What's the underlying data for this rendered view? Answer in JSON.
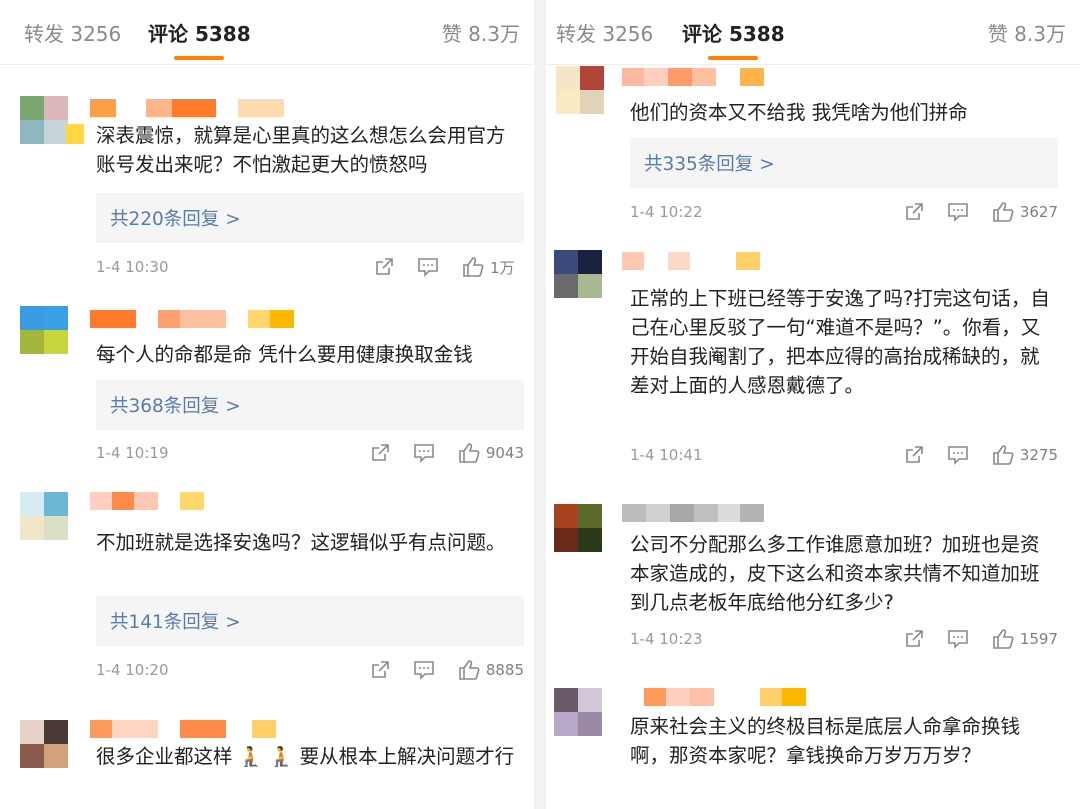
{
  "colors": {
    "accent": "#ff8200",
    "link": "#5a7ca7",
    "text": "#222222",
    "muted": "#9a9a9a"
  },
  "left": {
    "tabs": {
      "repost": "转发 3256",
      "comments": "评论 5388",
      "likes": "赞 8.3万"
    },
    "comments": [
      {
        "text": "深表震惊，就算是心里真的这么想怎么会用官方账号发出来呢？不怕激起更大的愤怒吗",
        "replies": "共220条回复 >",
        "time": "1-4 10:30",
        "likes": "1万"
      },
      {
        "text": "每个人的命都是命 凭什么要用健康换取金钱",
        "replies": "共368条回复 >",
        "time": "1-4 10:19",
        "likes": "9043"
      },
      {
        "text": "不加班就是选择安逸吗？这逻辑似乎有点问题。",
        "replies": "共141条回复 >",
        "time": "1-4 10:20",
        "likes": "8885"
      },
      {
        "text": "很多企业都这样 🧎 🧎 要从根本上解决问题才行"
      }
    ]
  },
  "right": {
    "tabs": {
      "repost": "转发 3256",
      "comments": "评论 5388",
      "likes": "赞 8.3万"
    },
    "comments": [
      {
        "text": "他们的资本又不给我 我凭啥为他们拼命",
        "replies": "共335条回复 >",
        "time": "1-4 10:22",
        "likes": "3627"
      },
      {
        "text": "正常的上下班已经等于安逸了吗?打完这句话，自己在心里反驳了一句“难道不是吗？”。你看，又开始自我阉割了，把本应得的高抬成稀缺的，就差对上面的人感恩戴德了。",
        "time": "1-4 10:41",
        "likes": "3275"
      },
      {
        "text": "公司不分配那么多工作谁愿意加班？加班也是资本家造成的，皮下这么和资本家共情不知道加班到几点老板年底给他分红多少?",
        "time": "1-4 10:23",
        "likes": "1597"
      },
      {
        "text": "原来社会主义的终极目标是底层人命拿命换钱啊，那资本家呢？拿钱换命万岁万万岁？"
      }
    ]
  },
  "icons": [
    "share-icon",
    "comment-icon",
    "like-icon"
  ]
}
